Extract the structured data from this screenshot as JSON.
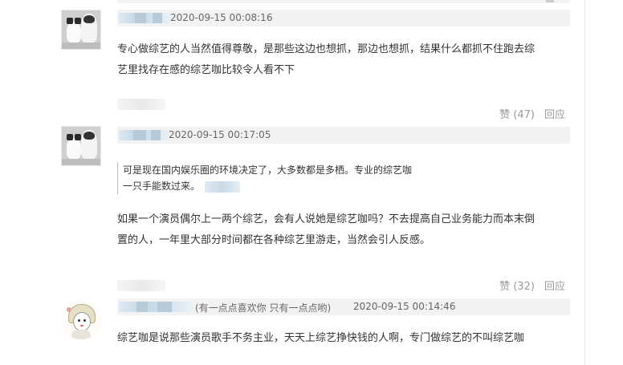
{
  "comments": [
    {
      "time": "2020-09-15 00:08:16",
      "text_lines": [
        "专心做综艺的人当然值得尊敬，是那些这边也想抓，那边也想抓，结果什么都抓不住跑去综",
        "艺里找存在感的综艺咖比较令人看不下"
      ],
      "like_label": "赞",
      "like_count": "(47)",
      "reply_label": "回应"
    },
    {
      "time": "2020-09-15 00:17:05",
      "quote_lines": [
        "可是现在国内娱乐圈的环境决定了，大多数都是多栖。专业的综艺咖",
        "一只手能数过来。"
      ],
      "text_lines": [
        "如果一个演员偶尔上一两个综艺，会有人说她是综艺咖吗？不去提高自己业务能力而本末倒",
        "置的人，一年里大部分时间都在各种综艺里游走，当然会引人反感。"
      ],
      "like_label": "赞",
      "like_count": "(32)",
      "reply_label": "回应"
    },
    {
      "nickname": "(有一点点喜欢你 只有一点点哟)",
      "time": "2020-09-15 00:14:46",
      "text_lines": [
        "综艺咖是说那些演员歌手不务主业，天天上综艺挣快钱的人啊，专门做综艺的不叫综艺咖"
      ]
    }
  ],
  "colors": {
    "header_bg": "#f2f2f2",
    "meta_text": "#666666",
    "action_text": "#999999",
    "body_text": "#333333"
  }
}
